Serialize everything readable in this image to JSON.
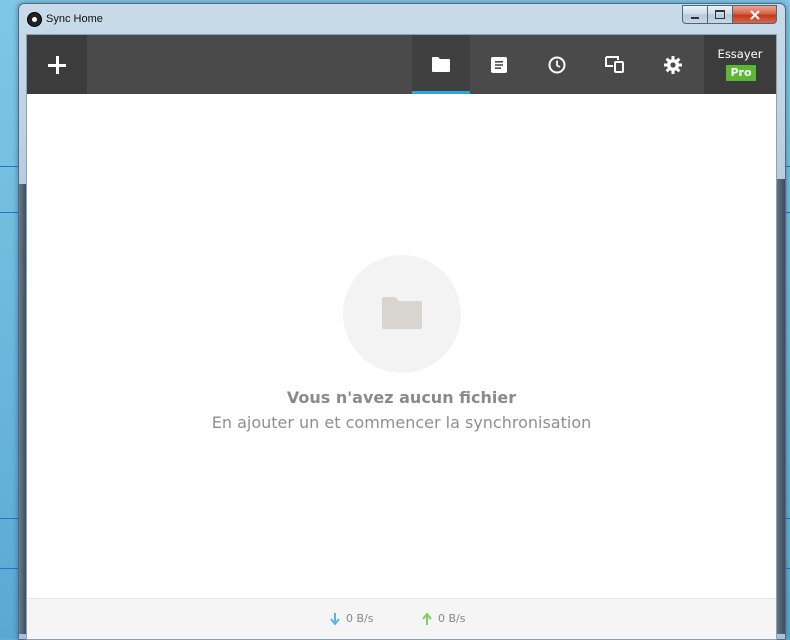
{
  "window": {
    "title": "Sync Home"
  },
  "toolbar": {
    "add_label": "+",
    "tabs": [
      {
        "name": "folders",
        "icon": "folder-icon",
        "active": true
      },
      {
        "name": "notes",
        "icon": "document-icon",
        "active": false
      },
      {
        "name": "history",
        "icon": "clock-icon",
        "active": false
      },
      {
        "name": "devices",
        "icon": "devices-icon",
        "active": false
      },
      {
        "name": "settings",
        "icon": "gear-icon",
        "active": false
      }
    ],
    "try_label": "Essayer",
    "pro_label": "Pro"
  },
  "empty_state": {
    "title": "Vous n'avez aucun fichier",
    "subtitle": "En ajouter un et commencer la synchronisation"
  },
  "status": {
    "download_speed": "0 B/s",
    "upload_speed": "0 B/s"
  },
  "colors": {
    "toolbar_bg": "#4a4a4a",
    "active_tab_indicator": "#29a8e0",
    "pro_badge": "#5bb833",
    "download_arrow": "#5ab4e6",
    "upload_arrow": "#7ccf5c"
  }
}
